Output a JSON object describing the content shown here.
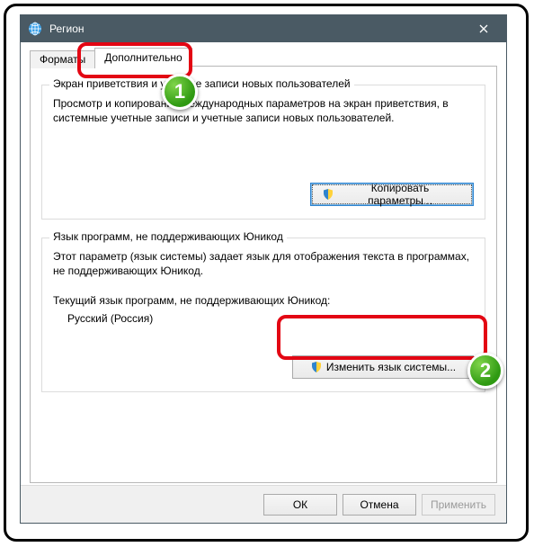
{
  "window": {
    "title": "Регион"
  },
  "tabs": {
    "formats": "Форматы",
    "advanced": "Дополнительно"
  },
  "group_welcome": {
    "legend": "Экран приветствия и учетные записи новых пользователей",
    "desc": "Просмотр и копирование международных параметров на экран приветствия, в системные учетные записи и учетные записи новых пользователей.",
    "copy_button": "Копировать параметры..."
  },
  "group_nonunicode": {
    "legend": "Язык программ, не поддерживающих Юникод",
    "desc": "Этот параметр (язык системы) задает язык для отображения текста в программах, не поддерживающих Юникод.",
    "current_label": "Текущий язык программ, не поддерживающих Юникод:",
    "current_value": "Русский (Россия)",
    "change_button": "Изменить язык системы..."
  },
  "footer": {
    "ok": "ОК",
    "cancel": "Отмена",
    "apply": "Применить"
  },
  "annotations": {
    "step1": "1",
    "step2": "2"
  }
}
